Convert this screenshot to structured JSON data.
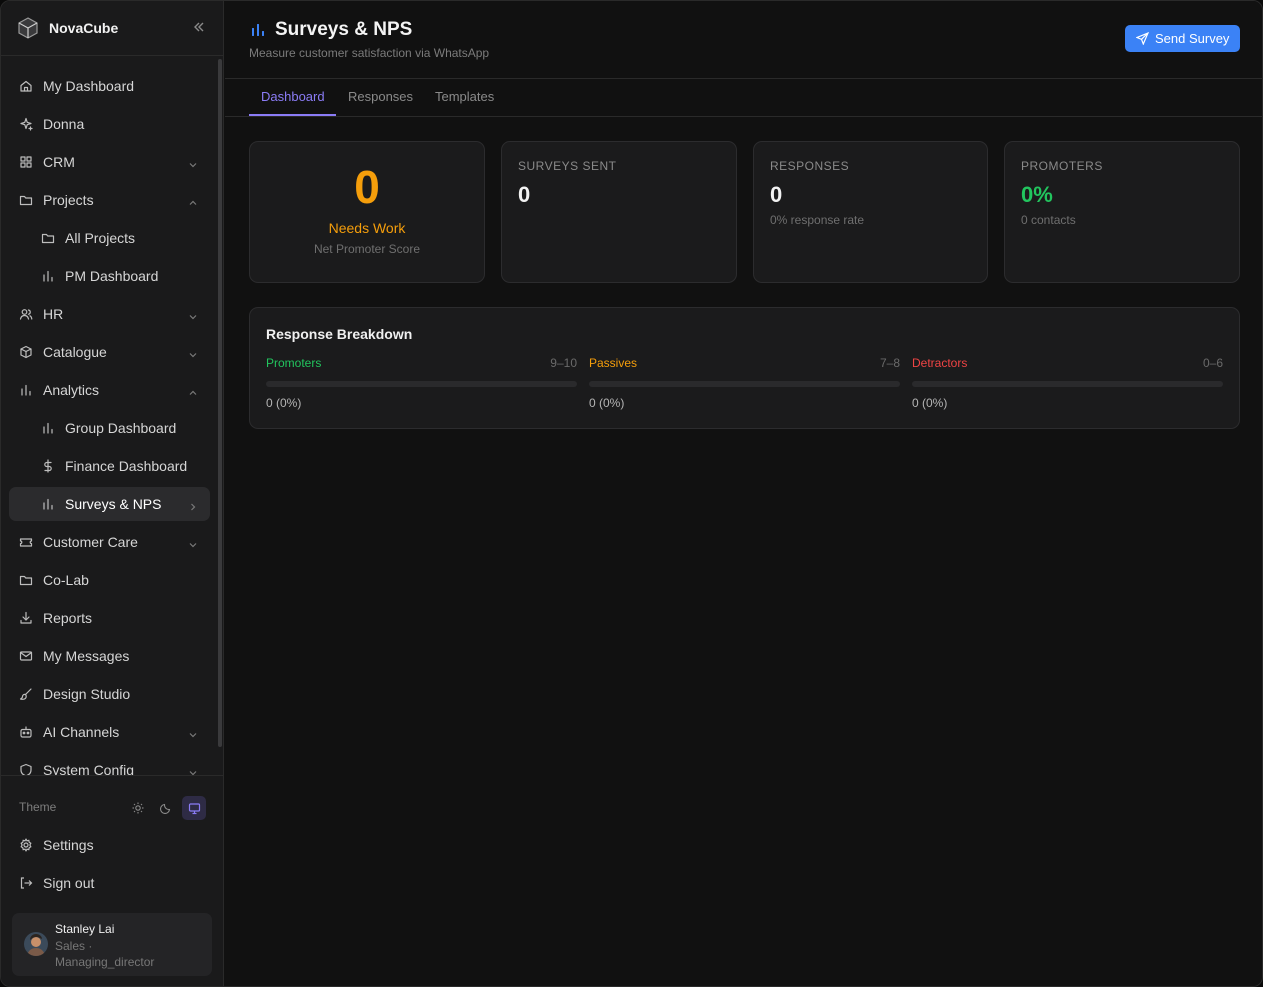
{
  "brand": {
    "name": "NovaCube"
  },
  "nav": [
    {
      "label": "My Dashboard",
      "icon": "home-icon",
      "sub": false,
      "chevron": ""
    },
    {
      "label": "Donna",
      "icon": "sparkle-icon",
      "sub": false,
      "chevron": ""
    },
    {
      "label": "CRM",
      "icon": "grid-icon",
      "sub": false,
      "chevron": "down"
    },
    {
      "label": "Projects",
      "icon": "folder-icon",
      "sub": false,
      "chevron": "up"
    },
    {
      "label": "All Projects",
      "icon": "folder-icon",
      "sub": true,
      "chevron": ""
    },
    {
      "label": "PM Dashboard",
      "icon": "bar-chart-icon",
      "sub": true,
      "chevron": ""
    },
    {
      "label": "HR",
      "icon": "users-icon",
      "sub": false,
      "chevron": "down"
    },
    {
      "label": "Catalogue",
      "icon": "box-icon",
      "sub": false,
      "chevron": "down"
    },
    {
      "label": "Analytics",
      "icon": "bar-chart-icon",
      "sub": false,
      "chevron": "up"
    },
    {
      "label": "Group Dashboard",
      "icon": "bar-chart-icon",
      "sub": true,
      "chevron": ""
    },
    {
      "label": "Finance Dashboard",
      "icon": "dollar-icon",
      "sub": true,
      "chevron": ""
    },
    {
      "label": "Surveys & NPS",
      "icon": "bar-chart-icon",
      "sub": true,
      "chevron": "right",
      "active": true
    },
    {
      "label": "Customer Care",
      "icon": "ticket-icon",
      "sub": false,
      "chevron": "down"
    },
    {
      "label": "Co-Lab",
      "icon": "folder-icon",
      "sub": false,
      "chevron": ""
    },
    {
      "label": "Reports",
      "icon": "download-icon",
      "sub": false,
      "chevron": ""
    },
    {
      "label": "My Messages",
      "icon": "mail-icon",
      "sub": false,
      "chevron": ""
    },
    {
      "label": "Design Studio",
      "icon": "brush-icon",
      "sub": false,
      "chevron": ""
    },
    {
      "label": "AI Channels",
      "icon": "bot-icon",
      "sub": false,
      "chevron": "down"
    },
    {
      "label": "System Config",
      "icon": "shield-icon",
      "sub": false,
      "chevron": "down"
    }
  ],
  "theme": {
    "label": "Theme",
    "selected": "system"
  },
  "bottom": {
    "settings": "Settings",
    "signout": "Sign out"
  },
  "user": {
    "name": "Stanley Lai",
    "role_line1": "Sales ·",
    "role_line2": "Managing_director"
  },
  "header": {
    "title": "Surveys & NPS",
    "subtitle": "Measure customer satisfaction via WhatsApp",
    "send_label": "Send Survey"
  },
  "tabs": [
    "Dashboard",
    "Responses",
    "Templates"
  ],
  "nps": {
    "score": "0",
    "status": "Needs Work",
    "caption": "Net Promoter Score"
  },
  "stats": {
    "sent": {
      "label": "SURVEYS SENT",
      "value": "0"
    },
    "responses": {
      "label": "RESPONSES",
      "value": "0",
      "note": "0% response rate"
    },
    "promoters": {
      "label": "PROMOTERS",
      "value": "0%",
      "note": "0 contacts"
    }
  },
  "breakdown": {
    "title": "Response Breakdown",
    "segments": [
      {
        "name": "Promoters",
        "range": "9–10",
        "count": "0 (0%)",
        "fraction": 0,
        "color": "#22c55e"
      },
      {
        "name": "Passives",
        "range": "7–8",
        "count": "0 (0%)",
        "fraction": 0,
        "color": "#f59e0b"
      },
      {
        "name": "Detractors",
        "range": "0–6",
        "count": "0 (0%)",
        "fraction": 0,
        "color": "#ef4444"
      }
    ]
  }
}
